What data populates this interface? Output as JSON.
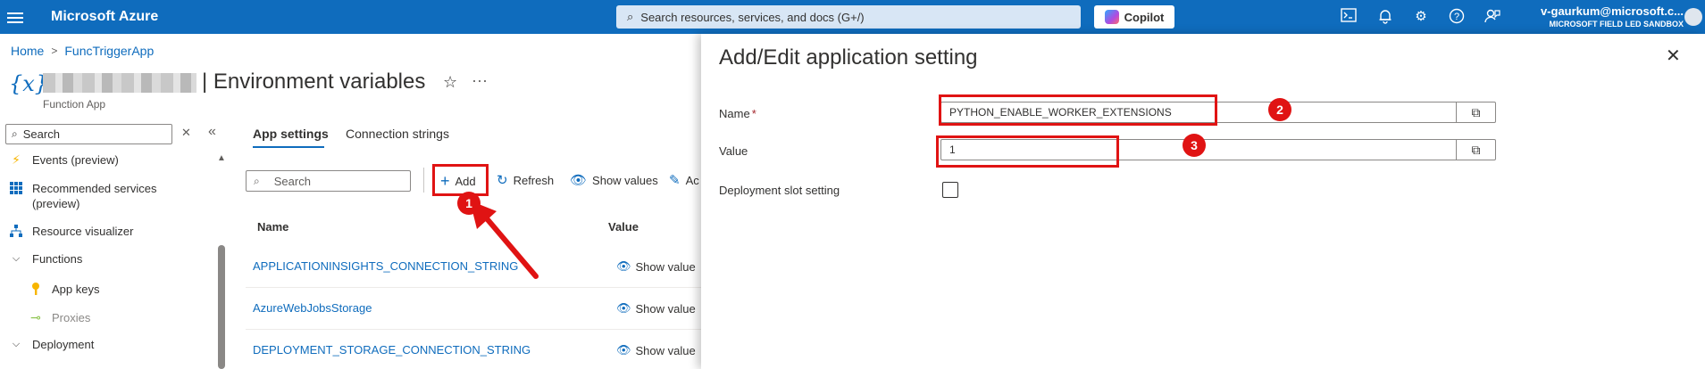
{
  "topbar": {
    "brand": "Microsoft Azure",
    "search_placeholder": "Search resources, services, and docs (G+/)",
    "copilot_label": "Copilot",
    "user_name": "v-gaurkum@microsoft.c...",
    "user_org": "MICROSOFT FIELD LED SANDBOX",
    "icons": [
      "cloud-shell-icon",
      "bell-icon",
      "gear-icon",
      "help-icon",
      "feedback-icon"
    ]
  },
  "breadcrumb": {
    "home": "Home",
    "app": "FuncTriggerApp"
  },
  "resource": {
    "icon_glyph": "{x}",
    "title": "| Environment variables",
    "subtitle": "Function App"
  },
  "nav": {
    "search_placeholder": "Search",
    "items": [
      {
        "label": "Events (preview)",
        "icon": "lightning-icon"
      },
      {
        "label": "Recommended services",
        "label2": "(preview)",
        "icon": "grid-icon"
      },
      {
        "label": "Resource visualizer",
        "icon": "hierarchy-icon"
      },
      {
        "label": "Functions",
        "icon": "chevron-down-icon"
      },
      {
        "label": "App keys",
        "icon": "key-icon"
      },
      {
        "label": "Proxies",
        "icon": "proxy-icon"
      },
      {
        "label": "Deployment",
        "icon": "chevron-down-icon"
      }
    ]
  },
  "main": {
    "tabs": [
      "App settings",
      "Connection strings"
    ],
    "search_placeholder": "Search",
    "toolbar": {
      "add": "Add",
      "refresh": "Refresh",
      "show_values": "Show values",
      "advanced": "Ac"
    },
    "columns": {
      "name": "Name",
      "value": "Value"
    },
    "rows": [
      {
        "name": "APPLICATIONINSIGHTS_CONNECTION_STRING",
        "value": "Show value"
      },
      {
        "name": "AzureWebJobsStorage",
        "value": "Show value"
      },
      {
        "name": "DEPLOYMENT_STORAGE_CONNECTION_STRING",
        "value": "Show value"
      }
    ]
  },
  "panel": {
    "title": "Add/Edit application setting",
    "name_label": "Name",
    "required_mark": "*",
    "name_value": "PYTHON_ENABLE_WORKER_EXTENSIONS",
    "value_label": "Value",
    "value_value": "1",
    "slot_label": "Deployment slot setting"
  },
  "annotations": {
    "b1": "1",
    "b2": "2",
    "b3": "3",
    "color": "#e01313"
  }
}
